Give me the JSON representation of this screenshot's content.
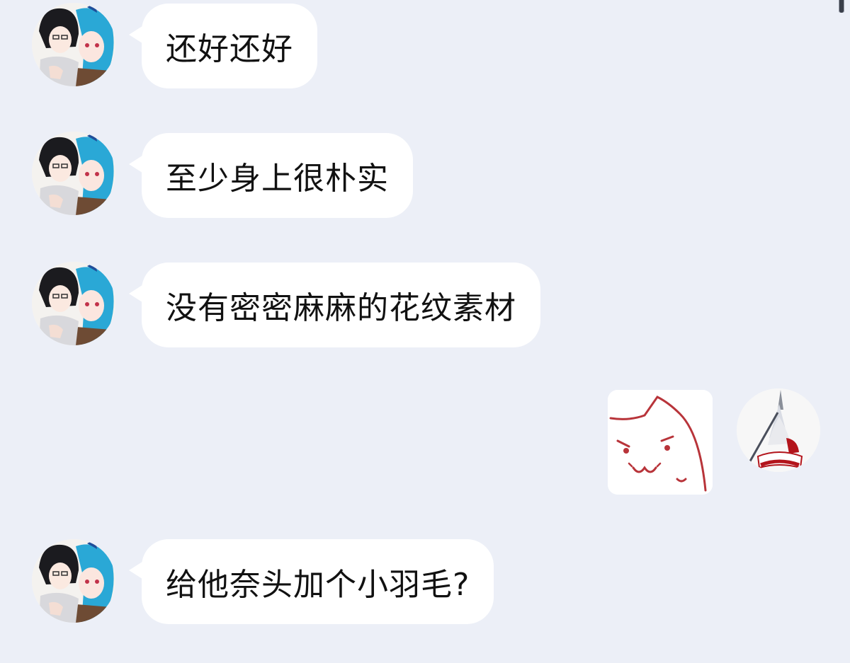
{
  "conversation": {
    "messages": [
      {
        "side": "left",
        "type": "text",
        "text": "还好还好",
        "avatar_icon": "anime-duo-avatar-icon"
      },
      {
        "side": "left",
        "type": "text",
        "text": "至少身上很朴实",
        "avatar_icon": "anime-duo-avatar-icon"
      },
      {
        "side": "left",
        "type": "text",
        "text": "没有密密麻麻的花纹素材",
        "avatar_icon": "anime-duo-avatar-icon"
      },
      {
        "side": "right",
        "type": "sticker",
        "sticker_icon": "smug-cat-sticker-icon",
        "avatar_icon": "feather-character-avatar-icon"
      },
      {
        "side": "left",
        "type": "text",
        "text": "给他奈头加个小羽毛?",
        "avatar_icon": "anime-duo-avatar-icon"
      }
    ]
  },
  "colors": {
    "background": "#eceff7",
    "bubble": "#ffffff",
    "text": "#111111"
  }
}
